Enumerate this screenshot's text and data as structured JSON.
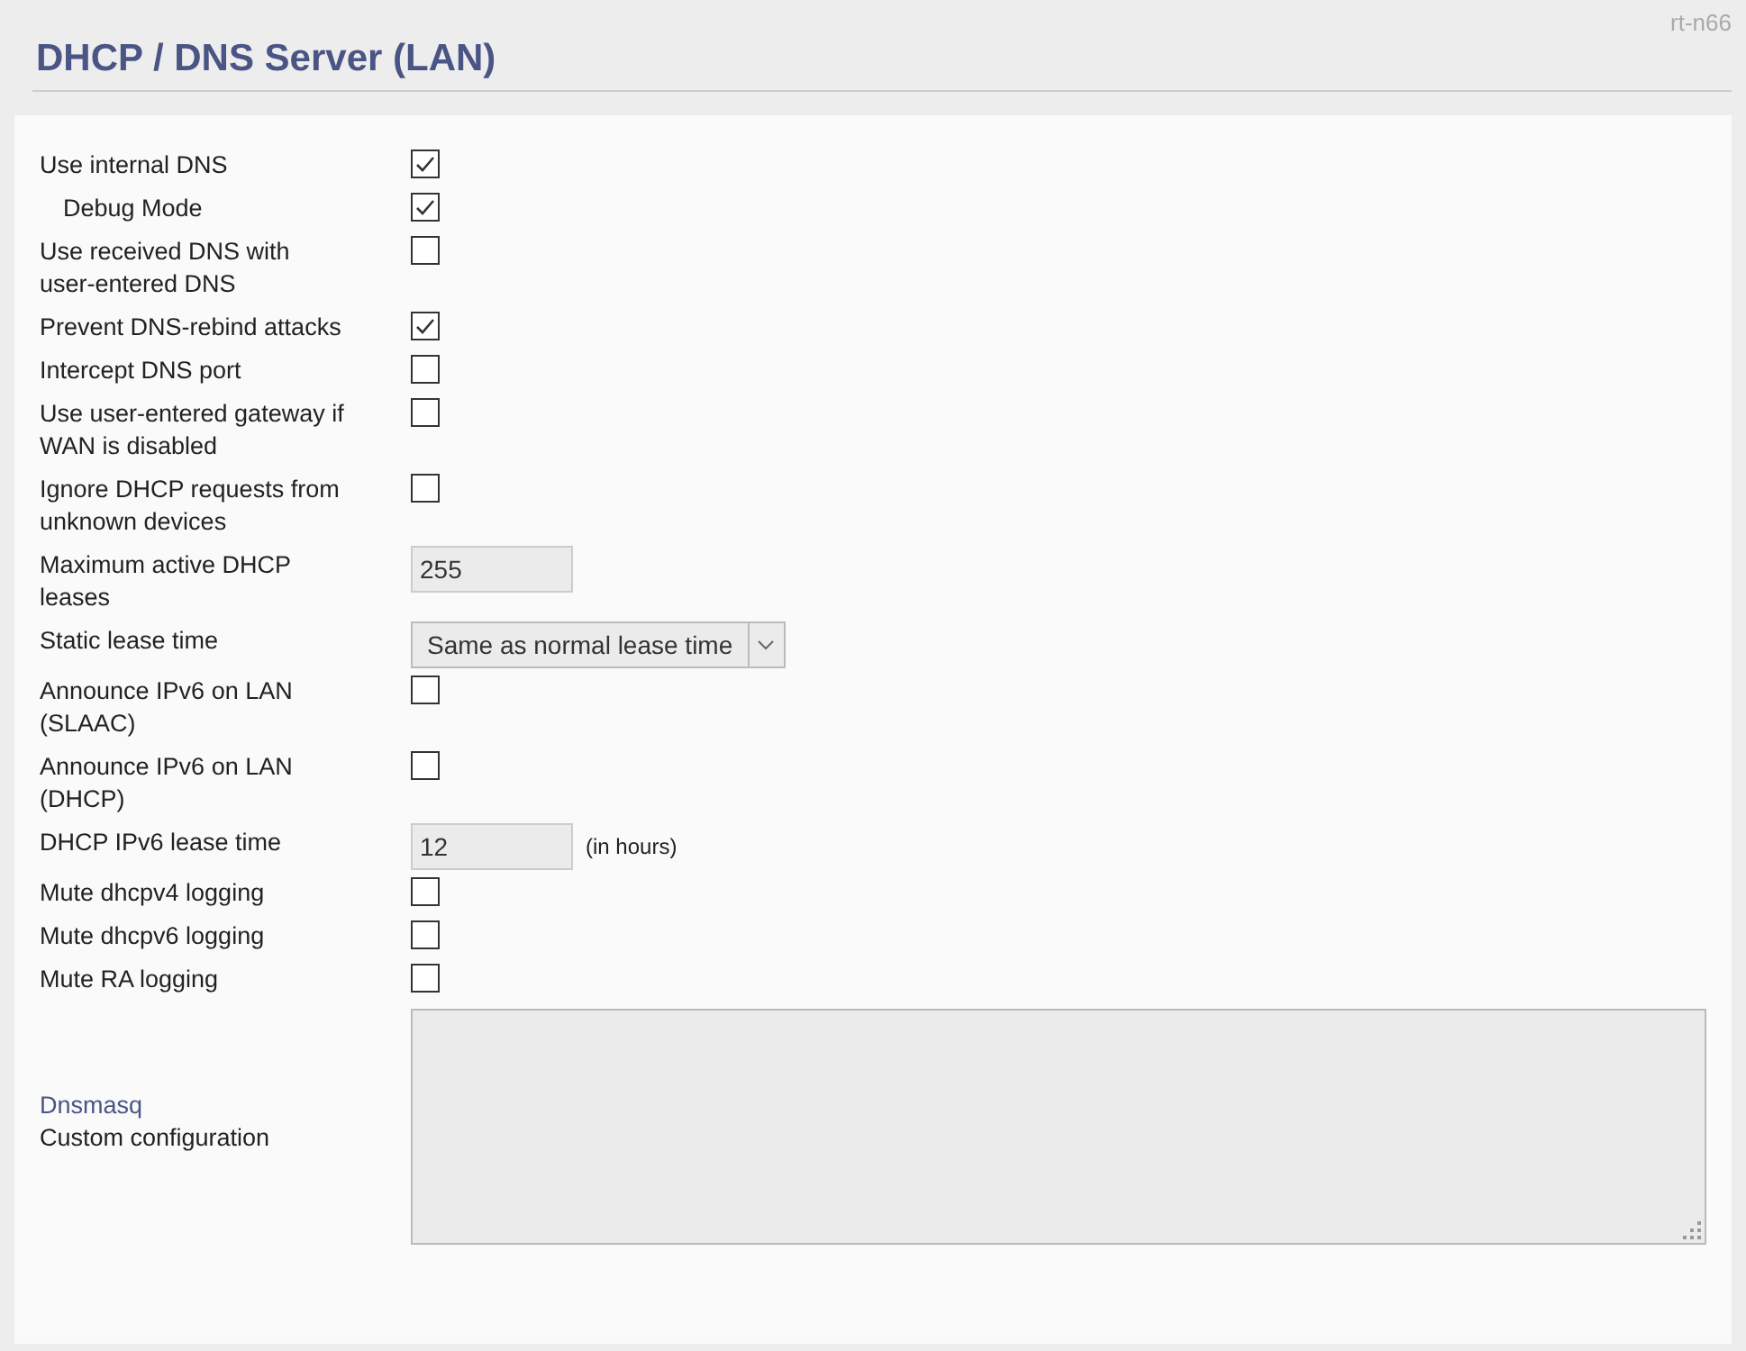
{
  "device": "rt-n66",
  "title": "DHCP / DNS Server (LAN)",
  "rows": [
    {
      "kind": "checkbox",
      "label": "Use internal DNS",
      "checked": true
    },
    {
      "kind": "checkbox",
      "label": "Debug Mode",
      "checked": true,
      "indented": true
    },
    {
      "kind": "checkbox",
      "label": "Use received DNS with user-entered DNS",
      "checked": false
    },
    {
      "kind": "checkbox",
      "label": "Prevent DNS-rebind attacks",
      "checked": true
    },
    {
      "kind": "checkbox",
      "label": "Intercept DNS port",
      "checked": false
    },
    {
      "kind": "checkbox",
      "label": "Use user-entered gateway if WAN is disabled",
      "checked": false
    },
    {
      "kind": "checkbox",
      "label": "Ignore DHCP requests from unknown devices",
      "checked": false
    },
    {
      "kind": "text",
      "label": "Maximum active DHCP leases",
      "value": "255"
    },
    {
      "kind": "select",
      "label": "Static lease time",
      "value": "Same as normal lease time"
    },
    {
      "kind": "checkbox",
      "label": "Announce IPv6 on LAN (SLAAC)",
      "checked": false
    },
    {
      "kind": "checkbox",
      "label": "Announce IPv6 on LAN (DHCP)",
      "checked": false
    },
    {
      "kind": "text",
      "label": "DHCP IPv6 lease time",
      "value": "12",
      "suffix": "(in hours)"
    },
    {
      "kind": "checkbox",
      "label": "Mute dhcpv4 logging",
      "checked": false
    },
    {
      "kind": "checkbox",
      "label": "Mute dhcpv6 logging",
      "checked": false
    },
    {
      "kind": "checkbox",
      "label": "Mute RA logging",
      "checked": false
    },
    {
      "kind": "textarea",
      "link": "Dnsmasq",
      "label": "Custom configuration"
    }
  ]
}
